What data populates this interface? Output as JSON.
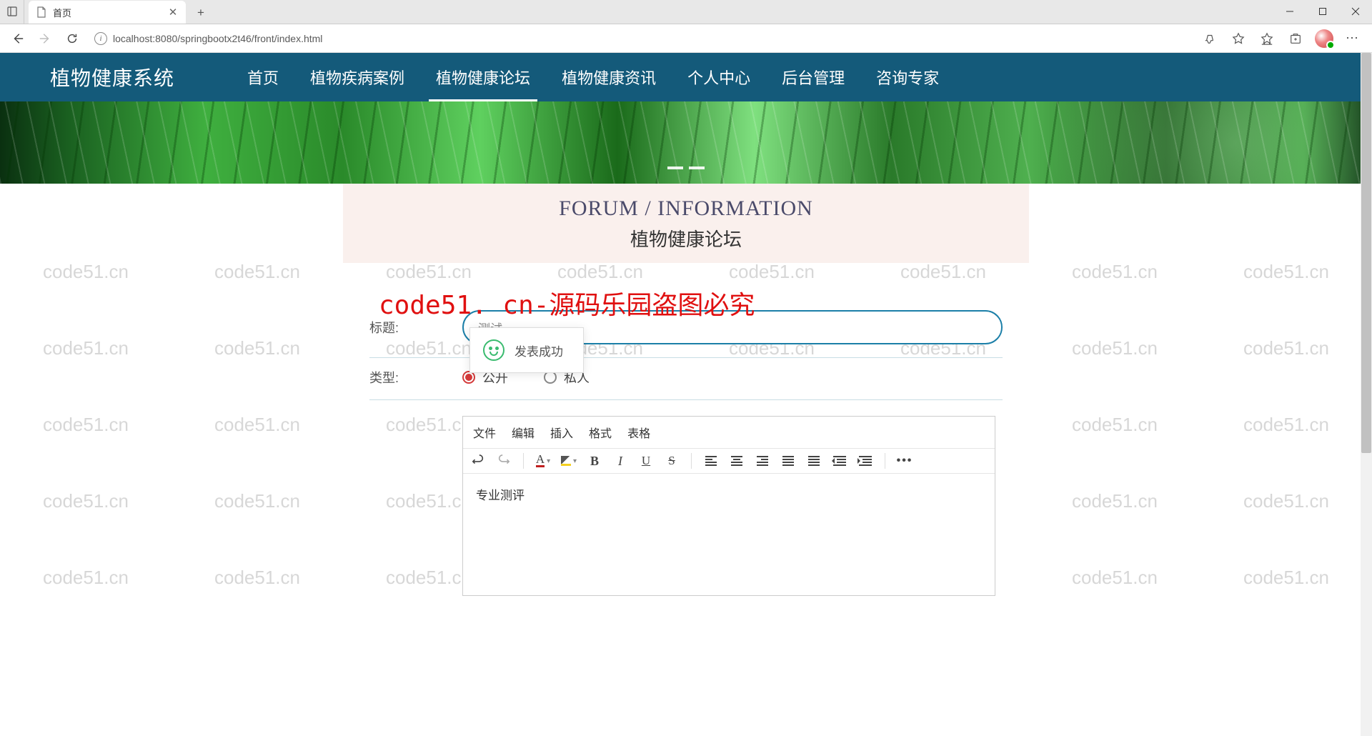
{
  "browser": {
    "tab_title": "首页",
    "url": "localhost:8080/springbootx2t46/front/index.html"
  },
  "watermark_text": "code51.cn",
  "red_watermark": "code51. cn-源码乐园盗图必究",
  "nav": {
    "logo": "植物健康系统",
    "items": [
      "首页",
      "植物疾病案例",
      "植物健康论坛",
      "植物健康资讯",
      "个人中心",
      "后台管理",
      "咨询专家"
    ],
    "active_index": 2
  },
  "section": {
    "en_title": "FORUM / INFORMATION",
    "cn_title": "植物健康论坛"
  },
  "form": {
    "title_label": "标题:",
    "title_value": "测试",
    "type_label": "类型:",
    "type_options": [
      "公开",
      "私人"
    ],
    "type_selected": 0
  },
  "editor": {
    "menus": [
      "文件",
      "编辑",
      "插入",
      "格式",
      "表格"
    ],
    "content": "专业测评"
  },
  "toast": {
    "message": "发表成功"
  }
}
